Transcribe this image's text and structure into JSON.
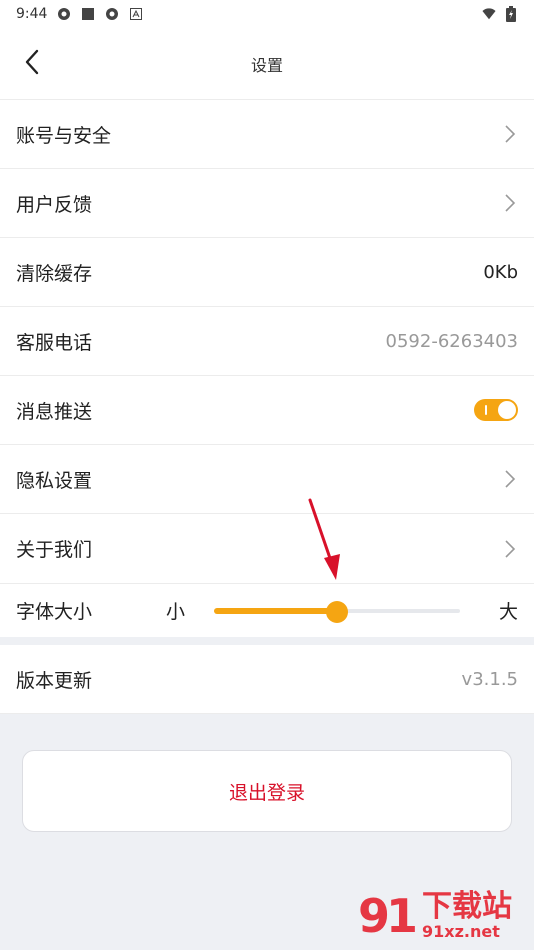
{
  "statusbar": {
    "time": "9:44"
  },
  "navbar": {
    "title": "设置"
  },
  "rows": [
    {
      "label": "账号与安全",
      "type": "link"
    },
    {
      "label": "用户反馈",
      "type": "link"
    },
    {
      "label": "清除缓存",
      "value": "0Kb"
    },
    {
      "label": "客服电话",
      "value": "0592-6263403"
    },
    {
      "label": "消息推送",
      "type": "toggle",
      "enabled": true
    },
    {
      "label": "隐私设置",
      "type": "link"
    },
    {
      "label": "关于我们",
      "type": "link"
    }
  ],
  "font_size": {
    "label": "字体大小",
    "small": "小",
    "large": "大",
    "level": 0.5
  },
  "version": {
    "label": "版本更新",
    "value": "v3.1.5"
  },
  "logout": {
    "label": "退出登录"
  },
  "watermark": {
    "logo": "91",
    "cn": "下载站",
    "en": "91xz.net"
  },
  "colors": {
    "accent": "#f5a512",
    "logout": "#d8112a",
    "annotation_arrow": "#d8112a"
  },
  "icons": {
    "back": "chevron-left-icon",
    "row_link": "chevron-right-icon"
  }
}
